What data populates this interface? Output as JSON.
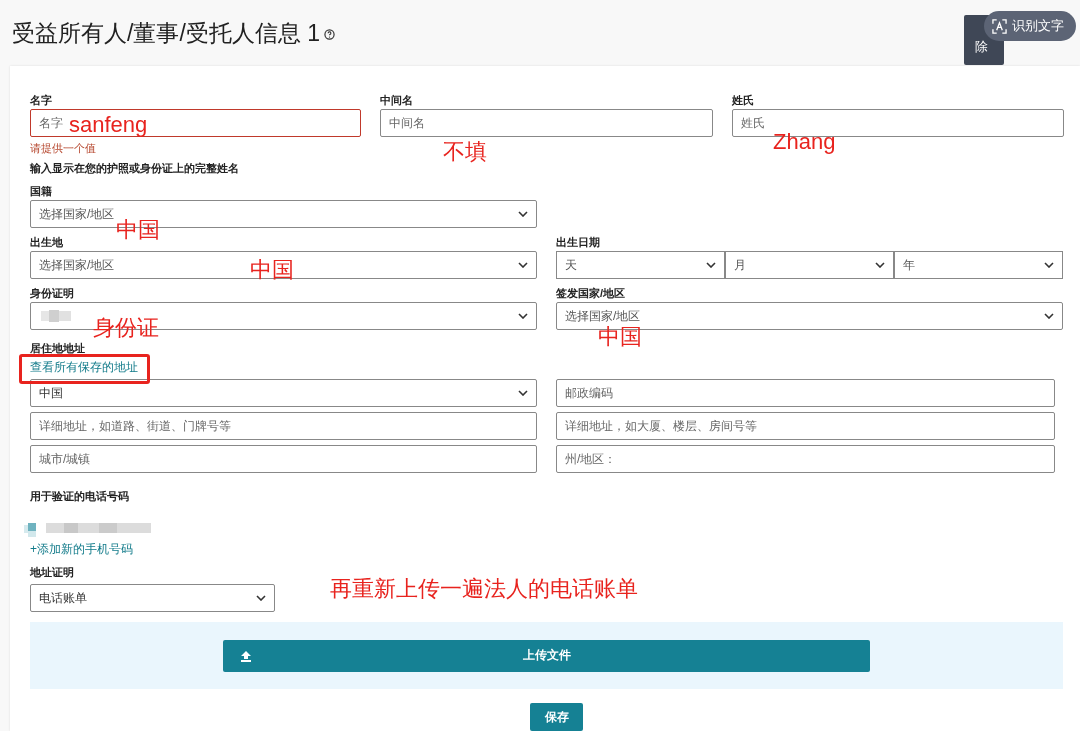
{
  "page": {
    "title": "受益所有人/董事/受托人信息 1"
  },
  "overlay": {
    "tooltip": "除",
    "ocr_button": "识别文字"
  },
  "name_fields": [
    {
      "label": "名字",
      "placeholder": "名字",
      "invalid": true
    },
    {
      "label": "中间名",
      "placeholder": "中间名",
      "invalid": false
    },
    {
      "label": "姓氏",
      "placeholder": "姓氏",
      "invalid": false
    }
  ],
  "name_error": "请提供一个值",
  "name_hint": "输入显示在您的护照或身份证上的完整姓名",
  "nationality": {
    "label": "国籍",
    "placeholder": "选择国家/地区"
  },
  "birthplace": {
    "label": "出生地",
    "placeholder": "选择国家/地区"
  },
  "birth_date": {
    "label": "出生日期",
    "parts": [
      "天",
      "月",
      "年"
    ]
  },
  "id_document": {
    "label": "身份证明"
  },
  "issuing_country": {
    "label": "签发国家/地区",
    "placeholder": "选择国家/地区"
  },
  "address": {
    "label": "居住地地址",
    "saved_link": "查看所有保存的地址",
    "country": "中国",
    "postal_placeholder": "邮政编码",
    "line1_placeholder": "详细地址，如道路、街道、门牌号等",
    "line2_placeholder": "详细地址，如大厦、楼层、房间号等",
    "city_placeholder": "城市/城镇",
    "state_placeholder": "州/地区："
  },
  "phone": {
    "label": "用于验证的电话号码",
    "add_link": "+添加新的手机号码"
  },
  "proof": {
    "label": "地址证明",
    "value": "电话账单"
  },
  "upload_button": "上传文件",
  "save_button": "保存",
  "annotations": [
    "sanfeng",
    "不填",
    "Zhang",
    "中国",
    "中国",
    "身份证",
    "中国",
    "再重新上传一遍法人的电话账单"
  ]
}
